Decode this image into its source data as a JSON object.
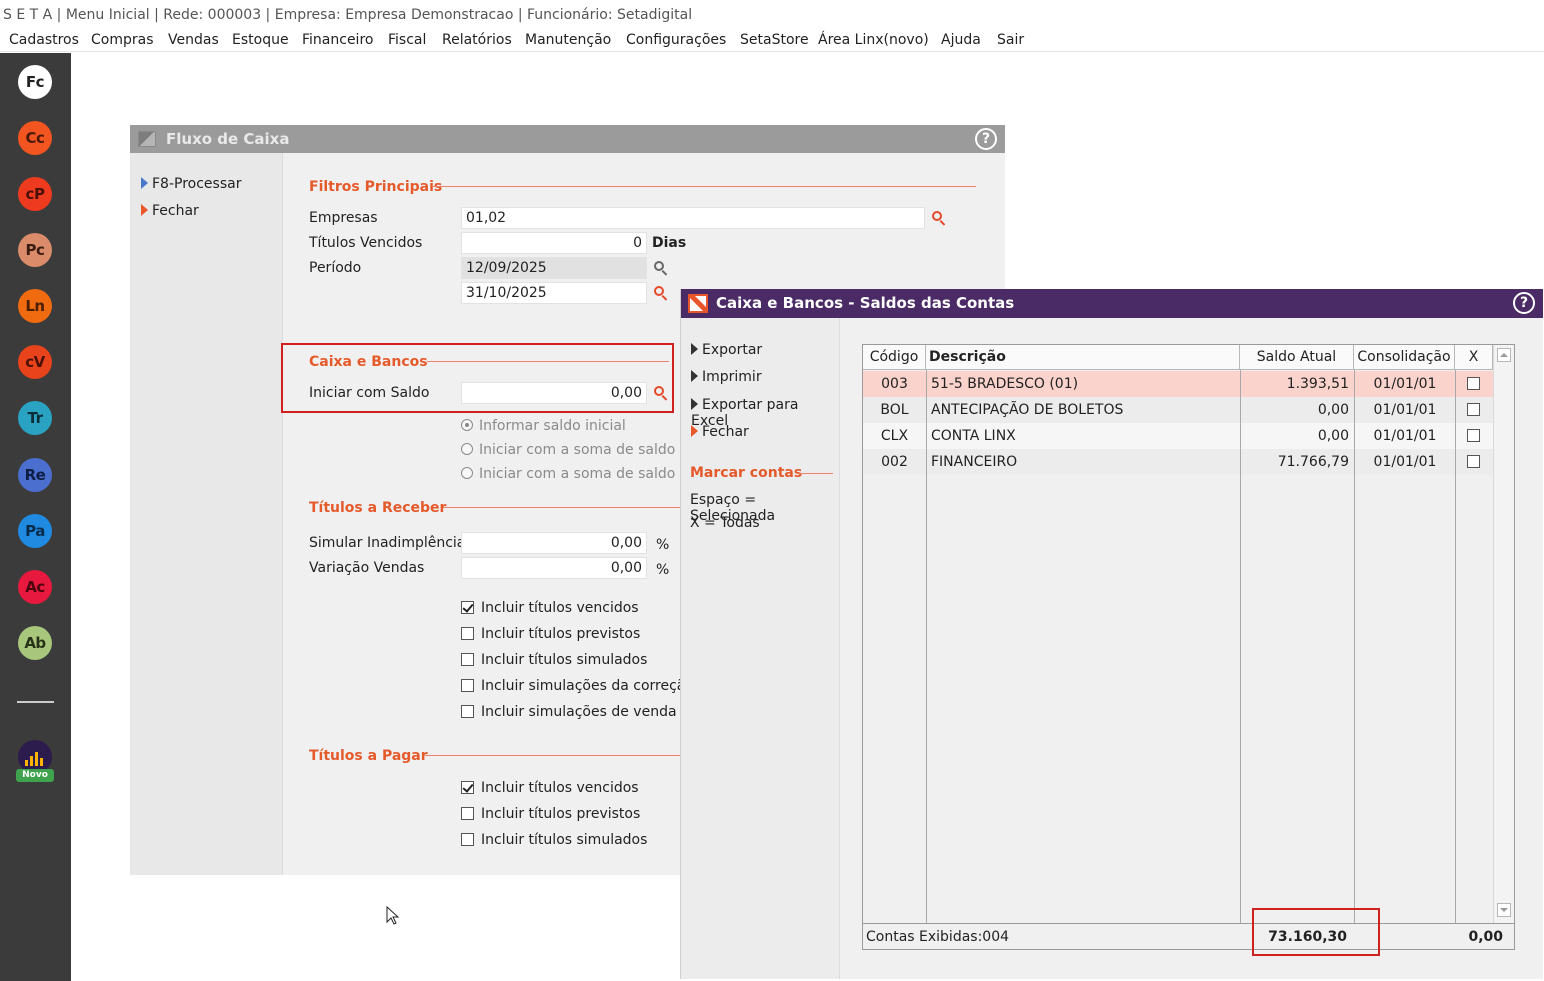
{
  "titlebar": {
    "text": "S E T A | Menu Inicial | Rede: 000003 | Empresa: Empresa Demonstracao | Funcionário: Setadigital"
  },
  "menu": [
    "Cadastros",
    "Compras",
    "Vendas",
    "Estoque",
    "Financeiro",
    "Fiscal",
    "Relatórios",
    "Manutenção",
    "Configurações",
    "SetaStore",
    "Área Linx(novo)",
    "Ajuda",
    "Sair"
  ],
  "sidebar": {
    "items": [
      {
        "abbr": "Fc",
        "color": "#ffffff",
        "text_color": "#222222"
      },
      {
        "abbr": "Cc",
        "color": "#f2551f",
        "text_color": "#4a1a08"
      },
      {
        "abbr": "cP",
        "color": "#ee3a1e",
        "text_color": "#4a1008"
      },
      {
        "abbr": "Pc",
        "color": "#d98b6a",
        "text_color": "#3a1c10"
      },
      {
        "abbr": "Ln",
        "color": "#f06a10",
        "text_color": "#4a1e02"
      },
      {
        "abbr": "cV",
        "color": "#e8431a",
        "text_color": "#4a1206"
      },
      {
        "abbr": "Tr",
        "color": "#2aa3c2",
        "text_color": "#0a2d38"
      },
      {
        "abbr": "Re",
        "color": "#4a6fcf",
        "text_color": "#0e1d44"
      },
      {
        "abbr": "Pa",
        "color": "#1f8ae0",
        "text_color": "#072b4a"
      },
      {
        "abbr": "Ac",
        "color": "#e8193e",
        "text_color": "#4a0510"
      },
      {
        "abbr": "Ab",
        "color": "#a8c77d",
        "text_color": "#263317"
      }
    ],
    "novo_label": "Novo"
  },
  "fluxo": {
    "title": "Fluxo de Caixa",
    "help": "?",
    "actions": [
      "F8-Processar",
      "Fechar"
    ],
    "filtros_title": "Filtros Principais",
    "empresas_label": "Empresas",
    "empresas_value": "01,02",
    "titulos_vencidos_label": "Títulos Vencidos",
    "titulos_vencidos_value": "0",
    "dias": "Dias",
    "periodo_label": "Período",
    "periodo_inicio": "12/09/2025",
    "periodo_fim": "31/10/2025",
    "caixa_title": "Caixa e Bancos",
    "iniciar_saldo_label": "Iniciar com Saldo",
    "iniciar_saldo_value": "0,00",
    "radios": [
      "Informar saldo inicial",
      "Iniciar com a soma de saldo de",
      "Iniciar com a soma de saldo de"
    ],
    "receber_title": "Títulos a Receber",
    "simular_label": "Simular Inadimplência",
    "simular_value": "0,00",
    "variacao_label": "Variação Vendas",
    "variacao_value": "0,00",
    "percent": "%",
    "receber_checks": [
      {
        "label": "Incluir títulos vencidos",
        "checked": true
      },
      {
        "label": "Incluir títulos previstos",
        "checked": false
      },
      {
        "label": "Incluir títulos simulados",
        "checked": false
      },
      {
        "label": "Incluir simulações da correção",
        "checked": false
      },
      {
        "label": "Incluir simulações de venda a v",
        "checked": false
      }
    ],
    "pagar_title": "Títulos a Pagar",
    "pagar_checks": [
      {
        "label": "Incluir títulos vencidos",
        "checked": true
      },
      {
        "label": "Incluir títulos previstos",
        "checked": false
      },
      {
        "label": "Incluir títulos simulados",
        "checked": false
      }
    ]
  },
  "caixa_bancos": {
    "title": "Caixa e Bancos - Saldos das Contas",
    "help": "?",
    "actions": [
      "Exportar",
      "Imprimir",
      "Exportar para Excel",
      "Fechar"
    ],
    "marcar_title": "Marcar contas",
    "marcar_lines": [
      "Espaço = Selecionada",
      "X = Todas"
    ],
    "columns": [
      "Código",
      "Descrição",
      "Saldo Atual",
      "Consolidação",
      "X"
    ],
    "rows": [
      {
        "codigo": "003",
        "descricao": "51-5 BRADESCO (01)",
        "saldo": "1.393,51",
        "consolidacao": "01/01/01"
      },
      {
        "codigo": "BOL",
        "descricao": "ANTECIPAÇÃO DE BOLETOS",
        "saldo": "0,00",
        "consolidacao": "01/01/01"
      },
      {
        "codigo": "CLX",
        "descricao": "CONTA LINX",
        "saldo": "0,00",
        "consolidacao": "01/01/01"
      },
      {
        "codigo": "002",
        "descricao": "FINANCEIRO",
        "saldo": "71.766,79",
        "consolidacao": "01/01/01"
      }
    ],
    "footer_count": "Contas Exibidas:004",
    "footer_total": "73.160,30",
    "footer_x": "0,00"
  },
  "colors": {
    "accent": "#e55a2b",
    "header_purple": "#4b2b66",
    "highlight_row": "#f9d3cc",
    "highlight_box": "#d02020"
  }
}
